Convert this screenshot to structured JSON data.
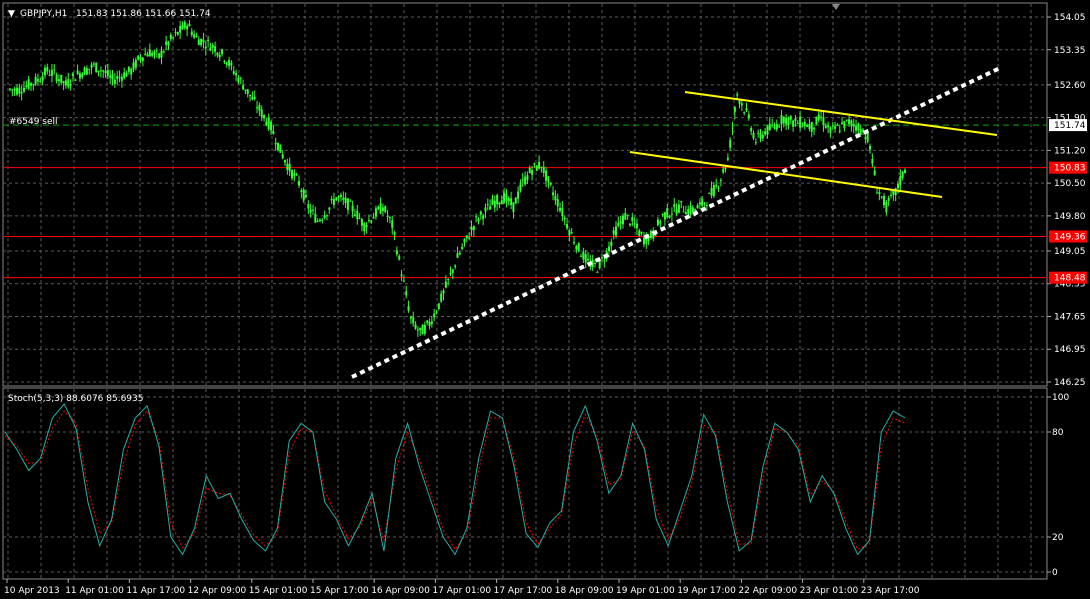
{
  "header": {
    "symbol": "GBPJPY,H1",
    "ohlc": "151.83 151.86 151.66 151.74"
  },
  "order_label": "#6549 sell",
  "indicator": {
    "label": "Stoch(5,3,3) 88.6076 85.6935",
    "levels": [
      "100",
      "80",
      "20",
      "0"
    ]
  },
  "price_axis": {
    "ticks": [
      "154.05",
      "153.35",
      "152.60",
      "151.90",
      "151.20",
      "150.50",
      "149.80",
      "149.05",
      "148.35",
      "147.65",
      "146.95",
      "146.25"
    ],
    "current_price": "151.74",
    "level_tags": [
      "150.83",
      "149.36",
      "148.48"
    ]
  },
  "time_axis": {
    "labels": [
      "10 Apr 2013",
      "11 Apr 01:00",
      "11 Apr 17:00",
      "12 Apr 09:00",
      "15 Apr 01:00",
      "15 Apr 17:00",
      "16 Apr 09:00",
      "17 Apr 01:00",
      "17 Apr 17:00",
      "18 Apr 09:00",
      "19 Apr 01:00",
      "19 Apr 17:00",
      "22 Apr 09:00",
      "23 Apr 01:00",
      "23 Apr 17:00"
    ]
  },
  "colors": {
    "background": "#000000",
    "grid": "#5a5a5a",
    "candles": "#33ff33",
    "level_lines": "#ff0000",
    "channel_lines": "#ffff00",
    "trendline": "#ffffff",
    "stoch_main": "#20b2aa",
    "stoch_signal": "#ff0000",
    "order_line": "#00aa00"
  },
  "chart_data": {
    "type": "line",
    "ylim": [
      146.25,
      154.05
    ],
    "horizontal_levels": [
      150.83,
      149.36,
      148.48
    ],
    "order_level": 151.74,
    "close_series": [
      152.5,
      152.6,
      152.7,
      152.9,
      152.8,
      152.6,
      152.8,
      152.9,
      153.0,
      152.9,
      152.7,
      152.8,
      152.9,
      153.2,
      153.3,
      153.2,
      153.5,
      153.7,
      153.9,
      153.6,
      153.5,
      153.4,
      153.2,
      152.9,
      152.6,
      152.3,
      152.0,
      151.7,
      151.2,
      150.8,
      150.5,
      150.0,
      149.7,
      149.9,
      150.2,
      150.1,
      149.9,
      149.6,
      149.8,
      150.0,
      149.6,
      148.6,
      147.6,
      147.3,
      147.5,
      147.9,
      148.4,
      148.9,
      149.3,
      149.7,
      149.9,
      150.1,
      150.2,
      150.0,
      150.5,
      150.8,
      150.9,
      150.4,
      150.0,
      149.5,
      149.1,
      148.8,
      148.7,
      149.0,
      149.5,
      149.8,
      149.6,
      149.3,
      149.4,
      149.8,
      149.9,
      150.0,
      149.9,
      150.0,
      150.2,
      150.5,
      151.0,
      152.4,
      152.0,
      151.4,
      151.6,
      151.7,
      151.9,
      151.8,
      151.8,
      151.7,
      151.9,
      151.6,
      151.7,
      151.8,
      151.7,
      151.5,
      150.4,
      150.0,
      150.3,
      150.8,
      151.74
    ],
    "stoch_main": [
      80,
      70,
      58,
      65,
      88,
      96,
      82,
      40,
      15,
      30,
      70,
      88,
      95,
      72,
      20,
      10,
      25,
      55,
      42,
      45,
      30,
      18,
      12,
      25,
      75,
      85,
      80,
      40,
      30,
      15,
      28,
      45,
      12,
      65,
      85,
      60,
      40,
      20,
      10,
      25,
      65,
      92,
      88,
      60,
      22,
      14,
      28,
      35,
      80,
      95,
      75,
      45,
      55,
      85,
      70,
      30,
      15,
      35,
      55,
      90,
      78,
      40,
      12,
      18,
      60,
      85,
      80,
      70,
      40,
      55,
      45,
      25,
      10,
      18,
      80,
      92,
      88
    ],
    "stoch_signal": [
      78,
      72,
      62,
      63,
      82,
      92,
      85,
      48,
      22,
      28,
      62,
      84,
      92,
      76,
      28,
      14,
      22,
      48,
      45,
      44,
      33,
      21,
      15,
      22,
      68,
      82,
      80,
      46,
      32,
      19,
      26,
      42,
      18,
      58,
      80,
      64,
      44,
      24,
      13,
      22,
      58,
      88,
      88,
      64,
      28,
      16,
      25,
      33,
      72,
      90,
      78,
      50,
      53,
      80,
      72,
      36,
      19,
      31,
      51,
      84,
      80,
      46,
      16,
      16,
      54,
      82,
      80,
      72,
      44,
      52,
      46,
      29,
      13,
      16,
      72,
      88,
      85
    ]
  }
}
